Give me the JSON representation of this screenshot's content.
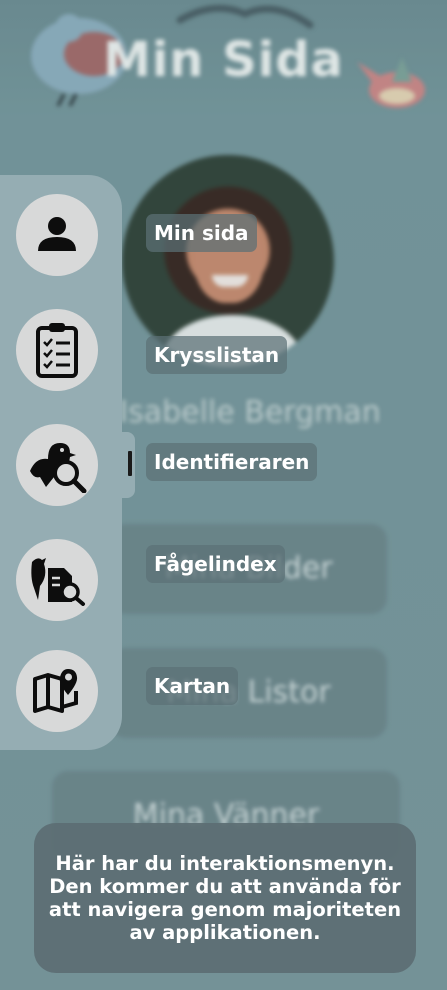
{
  "page": {
    "title": "Min Sida",
    "user_name": "Isabelle Bergman",
    "buttons": [
      "Mina Bilder",
      "Mina Listor",
      "Mina Vänner"
    ]
  },
  "menu": {
    "items": [
      {
        "label": "Min sida",
        "icon": "user-icon"
      },
      {
        "label": "Krysslistan",
        "icon": "checklist-icon"
      },
      {
        "label": "Identifieraren",
        "icon": "bird-search-icon"
      },
      {
        "label": "Fågelindex",
        "icon": "bird-index-icon"
      },
      {
        "label": "Kartan",
        "icon": "map-pin-icon"
      }
    ]
  },
  "tooltip": {
    "text": "Här har du interaktionsmenyn.\nDen kommer du att använda för\natt navigera genom majoriteten\nav applikationen."
  },
  "colors": {
    "background": "#7b999f",
    "menu_panel": "#95adb3",
    "menu_circle": "#d8d9d9",
    "tooltip_bg": "#5c6e73"
  }
}
